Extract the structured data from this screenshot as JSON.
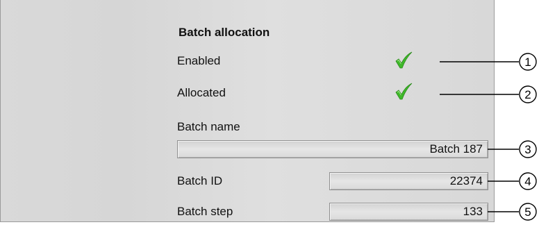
{
  "section": {
    "title": "Batch allocation",
    "enabled_label": "Enabled",
    "allocated_label": "Allocated",
    "batch_name_label": "Batch name",
    "batch_name_value": "Batch 187",
    "batch_id_label": "Batch ID",
    "batch_id_value": "22374",
    "batch_step_label": "Batch step",
    "batch_step_value": "133"
  },
  "status": {
    "enabled": true,
    "allocated": true,
    "check_color": "#3fb82a"
  },
  "callouts": [
    "1",
    "2",
    "3",
    "4",
    "5"
  ]
}
